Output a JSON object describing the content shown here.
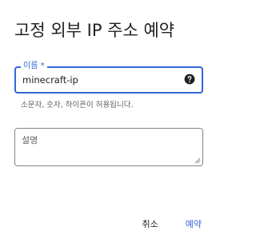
{
  "dialog": {
    "title": "고정 외부 IP 주소 예약"
  },
  "name_field": {
    "label": "이름 *",
    "value": "minecraft-ip",
    "help_icon": "help-circle-icon",
    "hint": "소문자, 숫자, 하이픈이 허용됩니다."
  },
  "description_field": {
    "placeholder": "설명",
    "value": ""
  },
  "actions": {
    "cancel_label": "취소",
    "reserve_label": "예약"
  },
  "colors": {
    "accent": "#3367d6",
    "text": "#202124",
    "secondary_text": "#5f6368",
    "border": "#80868b"
  }
}
